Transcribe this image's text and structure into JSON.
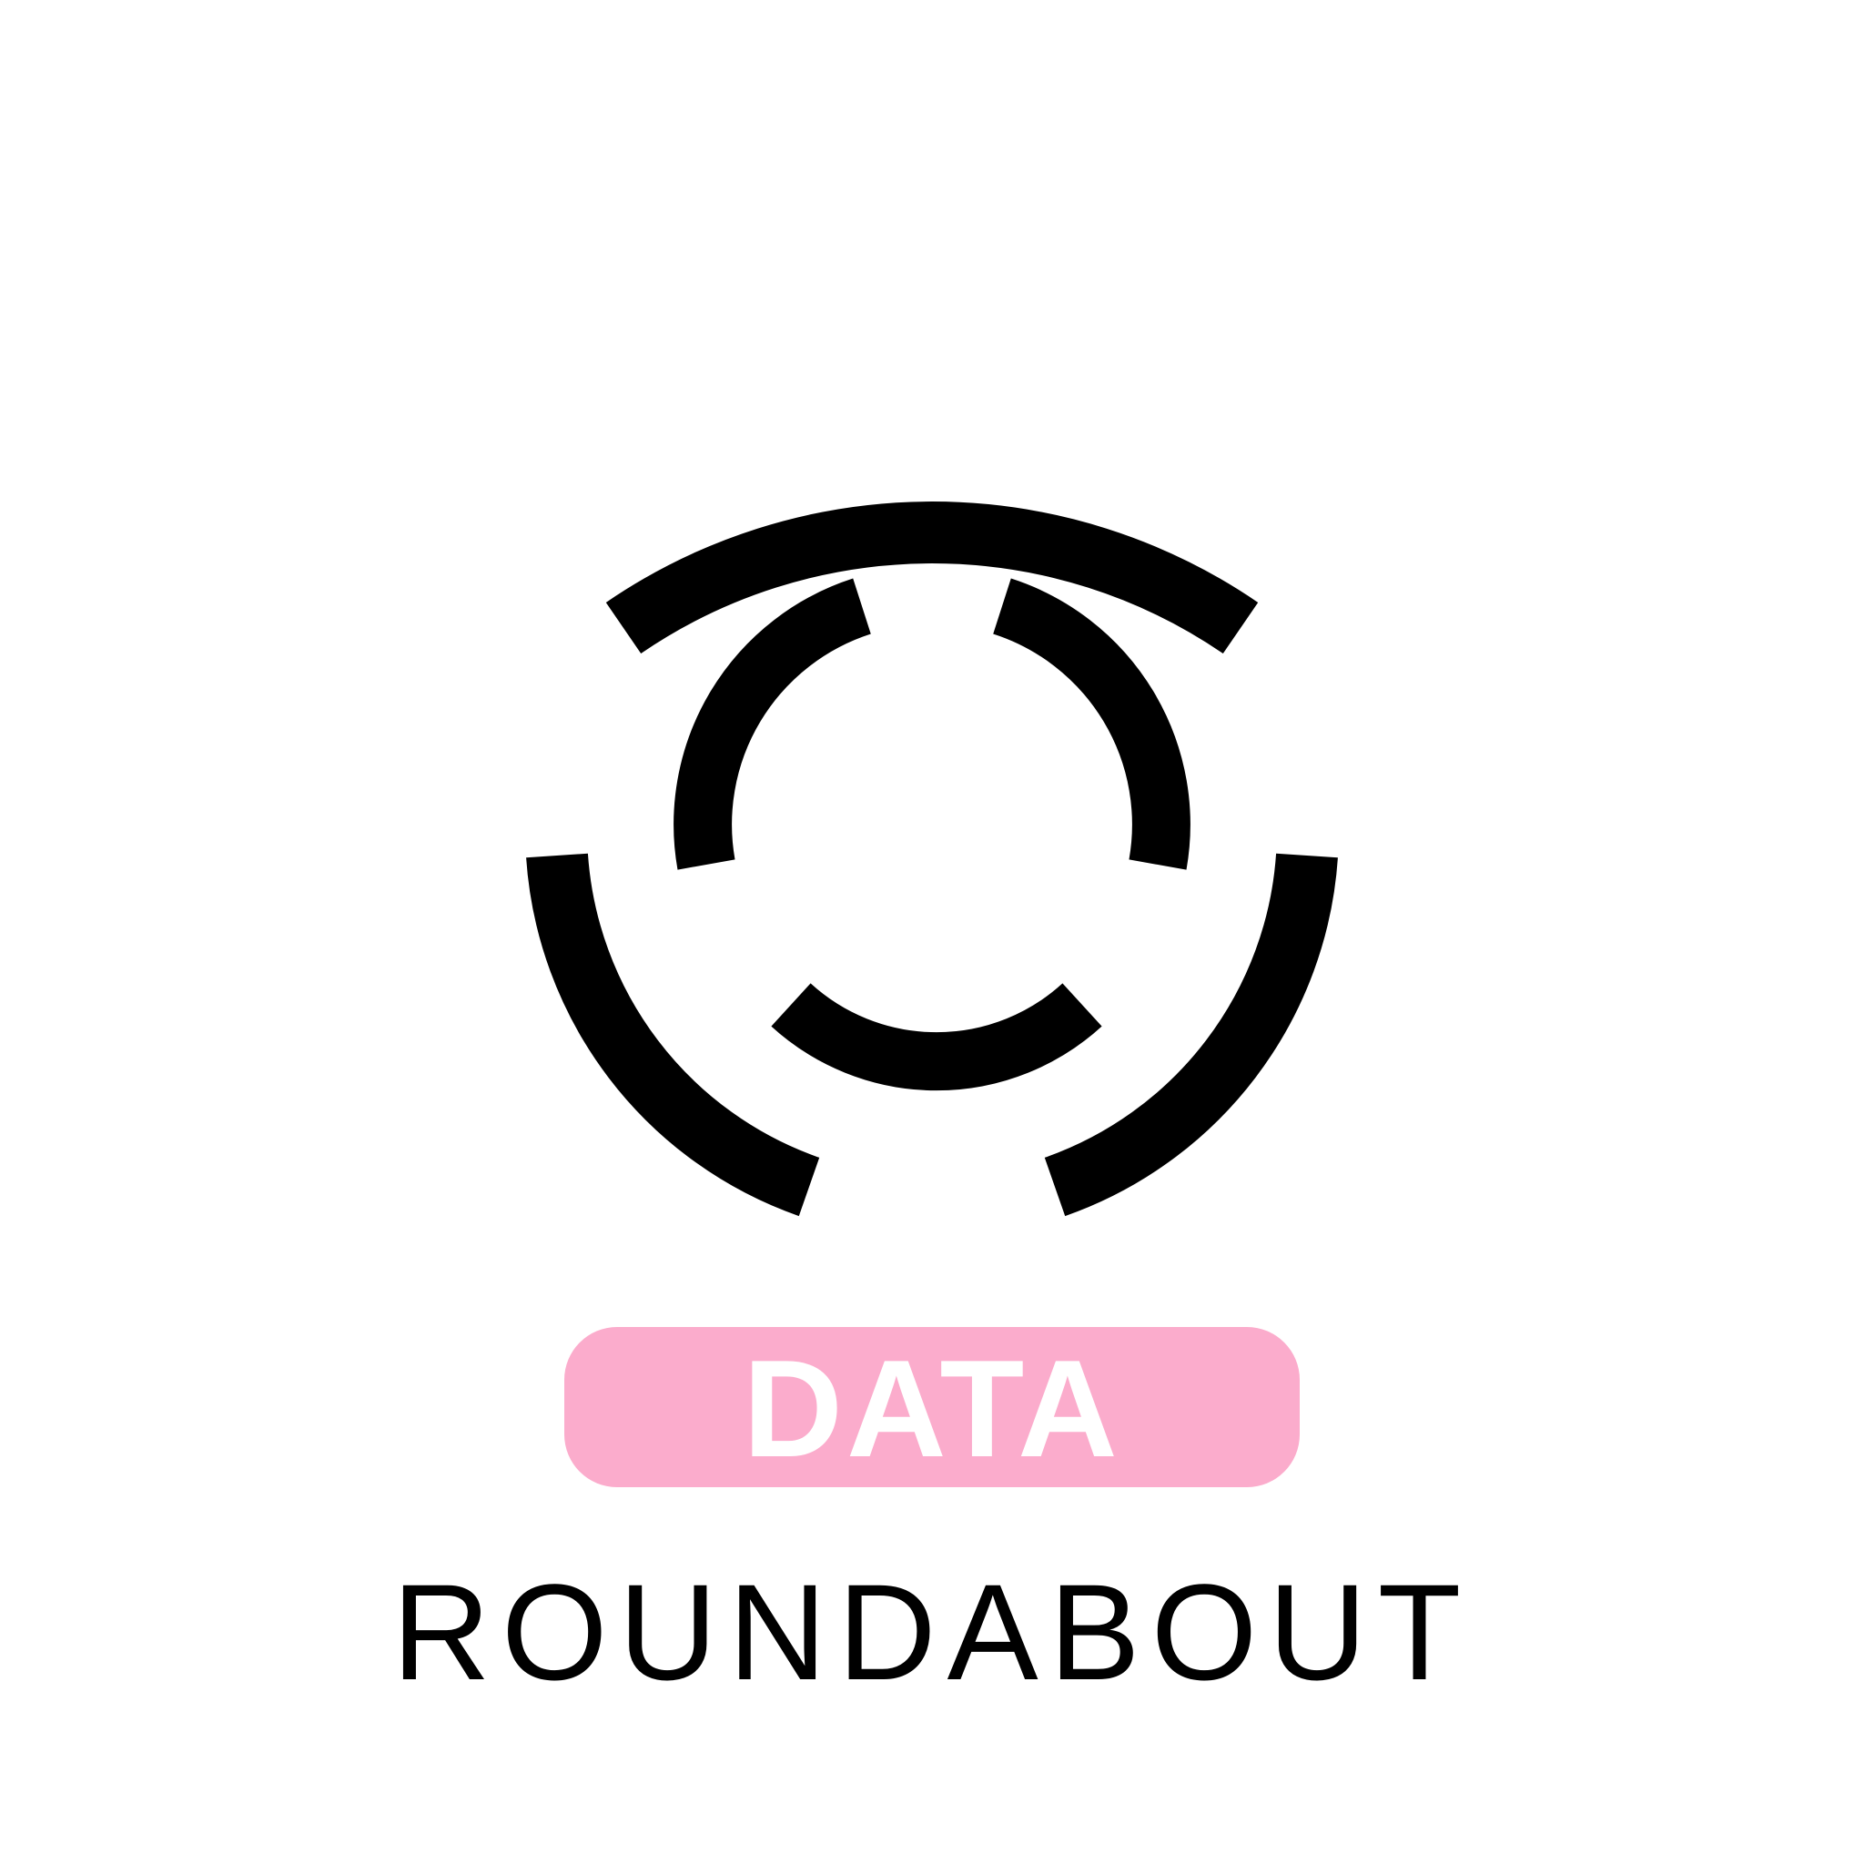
{
  "logo": {
    "icon": "roundabout-rings-icon",
    "badge_text": "DATA",
    "wordmark": "ROUNDABOUT"
  },
  "colors": {
    "background": "#ffffff",
    "mark": "#000000",
    "badge_fill": "#fbaccc",
    "badge_text": "#ffffff"
  }
}
